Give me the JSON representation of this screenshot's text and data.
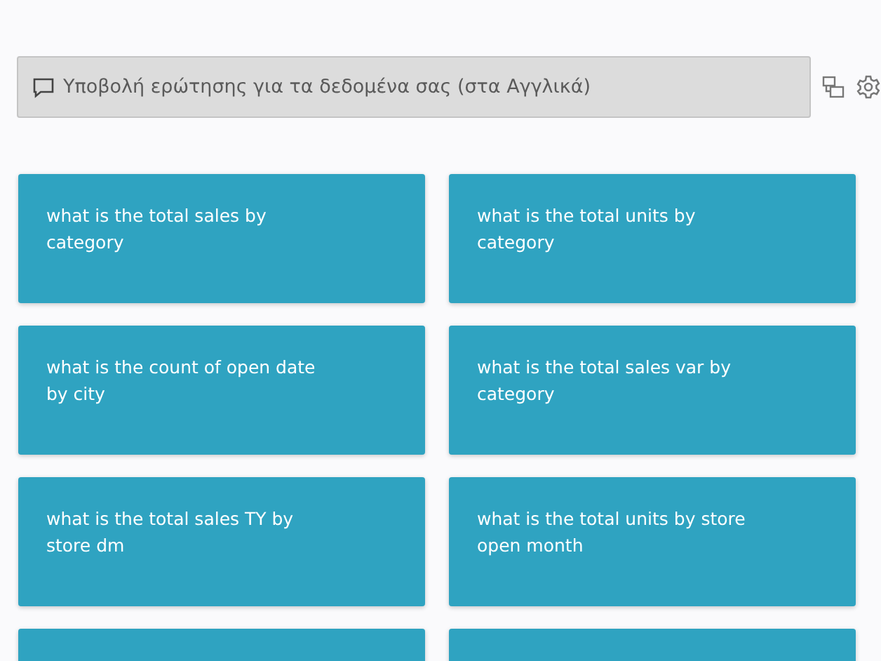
{
  "qa_bar": {
    "placeholder": "Υποβολή ερώτησης για τα δεδομένα σας (στα Αγγλικά)"
  },
  "suggestions": [
    {
      "text": "what is the total sales by category"
    },
    {
      "text": "what is the total units by category"
    },
    {
      "text": "what is the count of open date by city"
    },
    {
      "text": "what is the total sales var by category"
    },
    {
      "text": "what is the total sales TY by store dm"
    },
    {
      "text": "what is the total units by store open month"
    }
  ],
  "more_tiles_below": true
}
